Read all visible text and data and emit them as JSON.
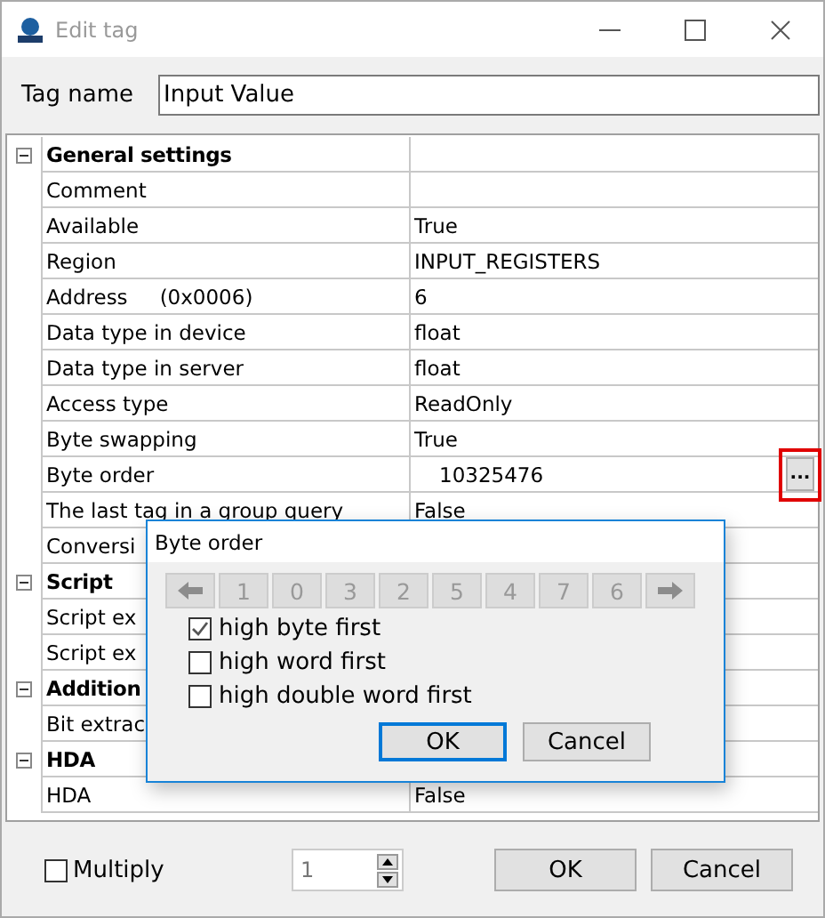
{
  "window": {
    "title": "Edit tag"
  },
  "tag_name": {
    "label": "Tag name",
    "value": "Input Value"
  },
  "grid": {
    "sections": [
      {
        "title": "General settings",
        "expanded": true,
        "rows": [
          {
            "name": "Comment"
          },
          {
            "name": "Available",
            "value": "True"
          },
          {
            "name": "Region",
            "value": "INPUT_REGISTERS"
          },
          {
            "name": "Address",
            "note": "(0x0006)",
            "value": "6"
          },
          {
            "name": "Data type in device",
            "value": "float"
          },
          {
            "name": "Data type in server",
            "value": "float"
          },
          {
            "name": "Access type",
            "value": "ReadOnly"
          },
          {
            "name": "Byte swapping",
            "value": "True"
          },
          {
            "name": "Byte order",
            "value": "10325476",
            "button": "...",
            "highlighted": true
          },
          {
            "name": "The last tag in a group query",
            "value": "False"
          },
          {
            "name": "Conversi"
          }
        ]
      },
      {
        "title": "Script",
        "expanded": true,
        "rows": [
          {
            "name": "Script ex"
          },
          {
            "name": "Script ex"
          }
        ]
      },
      {
        "title": "Addition",
        "expanded": true,
        "rows": [
          {
            "name": "Bit extrac"
          }
        ]
      },
      {
        "title": "HDA",
        "expanded": true,
        "rows": [
          {
            "name": "HDA",
            "value": "False"
          }
        ]
      }
    ]
  },
  "dialog": {
    "title": "Byte order",
    "order_buttons": [
      {
        "kind": "arrow-left",
        "disabled": true
      },
      {
        "kind": "digit",
        "label": "1",
        "disabled": true
      },
      {
        "kind": "digit",
        "label": "0",
        "disabled": true
      },
      {
        "kind": "digit",
        "label": "3",
        "disabled": true
      },
      {
        "kind": "digit",
        "label": "2",
        "disabled": true
      },
      {
        "kind": "digit",
        "label": "5",
        "disabled": true
      },
      {
        "kind": "digit",
        "label": "4",
        "disabled": true
      },
      {
        "kind": "digit",
        "label": "7",
        "disabled": true
      },
      {
        "kind": "digit",
        "label": "6",
        "disabled": true
      },
      {
        "kind": "arrow-right",
        "disabled": true
      }
    ],
    "options": [
      {
        "label": "high byte first",
        "checked": true
      },
      {
        "label": "high word first",
        "checked": false
      },
      {
        "label": "high double word first",
        "checked": false
      }
    ],
    "buttons": [
      {
        "label": "OK",
        "default": true
      },
      {
        "label": "Cancel",
        "default": false
      }
    ]
  },
  "footer": {
    "multiply": {
      "label": "Multiply",
      "checked": false
    },
    "count": "1",
    "buttons": [
      {
        "label": "OK"
      },
      {
        "label": "Cancel"
      }
    ]
  }
}
